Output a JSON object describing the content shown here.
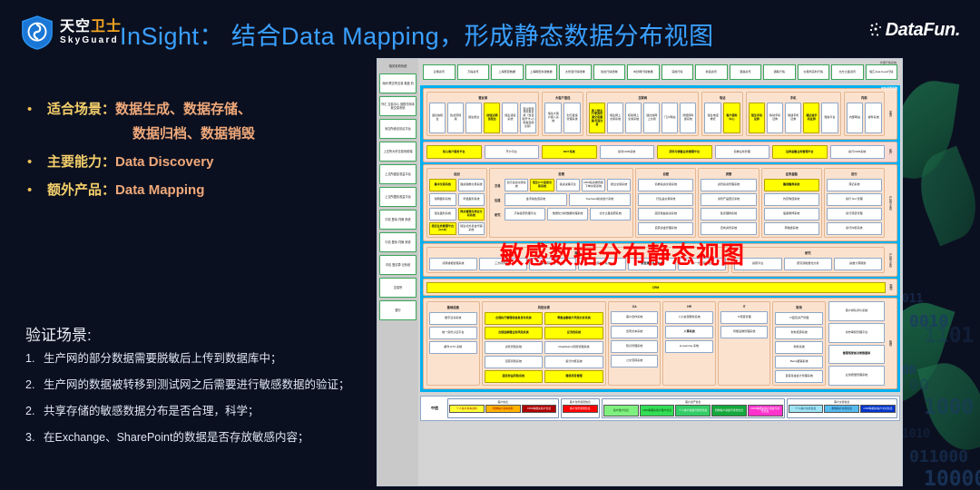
{
  "header": {
    "logo_cn_white": "天空",
    "logo_cn_yellow": "卫士",
    "logo_en": "SkyGuard",
    "title": "InSight： 结合Data Mapping，形成静态数据分布视图",
    "brand_right": "DataFun."
  },
  "bullets": [
    {
      "dot": "•",
      "label": "适合场景：",
      "value": "数据生成、数据存储、",
      "cont": "数据归档、数据销毁"
    },
    {
      "dot": "•",
      "label": "主要能力：",
      "value": "Data Discovery",
      "cont": ""
    },
    {
      "dot": "•",
      "label": "额外产品：",
      "value": "Data Mapping",
      "cont": ""
    }
  ],
  "verify": {
    "heading": "验证场景:",
    "items": [
      {
        "num": "1.",
        "text": "生产网的部分数据需要脱敏后上传到数据库中；"
      },
      {
        "num": "2.",
        "text": "生产网的数据被转移到测试网之后需要进行敏感数据的验证；"
      },
      {
        "num": "2.",
        "text": "共享存储的敏感数据分布是否合理，科学；"
      },
      {
        "num": "3.",
        "text": "在Exchange、SharePoint的数据是否存放敏感内容；"
      }
    ]
  },
  "diagram": {
    "red_overlay": "敏感数据分布静态视图",
    "side_caption": "相关机构系统",
    "side_boxes": [
      "深圳 联交所交易 报盘 机",
      "外汇 交易中心 回顾打网本 报交易系统",
      "深交所综合协议平台",
      "上交所大宗交易系统端",
      "上交所固定收益平台",
      "上交所国债收益平台",
      "中债 登标 托管 系统",
      "中债 登标 托管 系统",
      "中债 登清算 记系统",
      "交易所",
      "银行"
    ],
    "top_caption": "外部行情系统",
    "top_boxes": [
      "彭博资讯",
      "万得资讯",
      "上海聚源数据",
      "上海朝阳永续数据",
      "大智慧行情终端",
      "钱龙行情终端",
      "中钞网行情数据",
      "深成行情",
      "新浪资讯",
      "港澳资讯",
      "通联行情",
      "交易所实时行情",
      "北方之星资讯",
      "恒汇data Feed行情"
    ],
    "blue_caption": "中信证券系统",
    "channel_vert": "渠道",
    "channel_groups": [
      {
        "title": "营业部",
        "cells": [
          {
            "t": "通达信柜台",
            "hl": false
          },
          {
            "t": "钱龙现场版",
            "hl": false
          },
          {
            "t": "恒生柜台",
            "hl": false
          },
          {
            "t": "创信达期货柜台",
            "hl": true
          },
          {
            "t": "恒生通道系统",
            "hl": false
          },
          {
            "t": "营业部现场交易系统（含自助开卡+小键盘自助交易）",
            "hl": false
          }
        ]
      },
      {
        "title": "大客户直连",
        "cells": [
          {
            "t": "恒生大客户接入系统",
            "hl": false
          },
          {
            "t": "创元极速管理系统",
            "hl": false
          }
        ]
      },
      {
        "title": "互联网",
        "cells": [
          {
            "t": "网上营业厅/机构打通交易渠道/页面交易",
            "hl": true
          },
          {
            "t": "恒生网上交易系统",
            "hl": false
          },
          {
            "t": "核新网上交易系统",
            "hl": false
          },
          {
            "t": "通达信网上交易",
            "hl": false
          },
          {
            "t": "门户网站",
            "hl": false
          },
          {
            "t": "智能即时通系统",
            "hl": false
          }
        ]
      },
      {
        "title": "电话",
        "cells": [
          {
            "t": "恒生电话委托",
            "hl": false
          },
          {
            "t": "客户服务中心",
            "hl": true
          }
        ]
      },
      {
        "title": "手机",
        "cells": [
          {
            "t": "恒生手机证券",
            "hl": true
          },
          {
            "t": "移动手机证券",
            "hl": false
          },
          {
            "t": "联通手机证券",
            "hl": false
          },
          {
            "t": "通达信手机证券",
            "hl": true
          },
          {
            "t": "短信平台",
            "hl": false
          }
        ]
      },
      {
        "title": "内部",
        "cells": [
          {
            "t": "内部网站",
            "hl": false
          },
          {
            "t": "邮件系统",
            "hl": false
          }
        ]
      }
    ],
    "service_vert": "客户",
    "service_row": [
      {
        "t": "核心客户服务平台",
        "hl": true
      },
      {
        "t": "开户平台",
        "hl": false
      },
      {
        "t": "MOT系统",
        "hl": true
      },
      {
        "t": "投管CRM系统",
        "hl": false
      },
      {
        "t": "研究与销售业务管理平台",
        "hl": true
      },
      {
        "t": "债券业务管理",
        "hl": false
      },
      {
        "t": "证券金融业务管理平台",
        "hl": true
      },
      {
        "t": "投行CRM系统",
        "hl": false
      }
    ],
    "product_vert": "产品与业务",
    "biz_groups": [
      {
        "title": "经纪",
        "rows": [
          [
            {
              "t": "集中交易系统",
              "hl": true
            },
            {
              "t": "融资融券交易系统",
              "hl": false
            }
          ],
          [
            {
              "t": "恒网盈利系统",
              "hl": false
            },
            {
              "t": "华鑫盈利系统",
              "hl": false
            }
          ],
          [
            {
              "t": "恒生盈利系统",
              "hl": false
            },
            {
              "t": "网点管理与综合分析系统",
              "hl": true
            }
          ],
          [
            {
              "t": "经纪业务管理平台（BAM）",
              "hl": true
            },
            {
              "t": "恒生境外基金代销系统",
              "hl": false
            }
          ]
        ]
      },
      {
        "title": "投管",
        "labeled_rows": [
          {
            "label": "交易",
            "cells": [
              {
                "t": "创元投资交易系统",
                "hl": false
              },
              {
                "t": "恒生ETF投资交易系统",
                "hl": true
              },
              {
                "t": "投资决策平台",
                "hl": false
              },
              {
                "t": "CRM投资委员和下单交易系统",
                "hl": false
              },
              {
                "t": "柜台交易系统",
                "hl": false
              }
            ]
          },
          {
            "label": "估值",
            "cells": [
              {
                "t": "金手指估值系统",
                "hl": false
              },
              {
                "t": "SunGard投资会计系统",
                "hl": false
              }
            ]
          },
          {
            "label": "研究",
            "cells": [
              {
                "t": "万得投研管理平台",
                "hl": false
              },
              {
                "t": "数量化分析数据处理系统",
                "hl": false
              },
              {
                "t": "北方之星投研系统",
                "hl": false
              }
            ]
          }
        ]
      },
      {
        "title": "自营",
        "rows": [
          [
            {
              "t": "债券投资交易系统",
              "hl": false
            }
          ],
          [
            {
              "t": "衍生品交易系统",
              "hl": false
            }
          ],
          [
            {
              "t": "固定收益投资系统",
              "hl": false
            }
          ],
          [
            {
              "t": "自营资金管理系统",
              "hl": false
            }
          ]
        ]
      },
      {
        "title": "资管",
        "rows": [
          [
            {
              "t": "资管投资管理系统",
              "hl": false
            }
          ],
          [
            {
              "t": "资管产品登记系统",
              "hl": false
            }
          ],
          [
            {
              "t": "集合理财系统",
              "hl": false
            }
          ],
          [
            {
              "t": "定向资管系统",
              "hl": false
            }
          ]
        ]
      },
      {
        "title": "证券金融",
        "rows": [
          [
            {
              "t": "融资融券系统",
              "hl": true
            }
          ],
          [
            {
              "t": "约定购回系统",
              "hl": false
            }
          ],
          [
            {
              "t": "股票质押系统",
              "hl": false
            }
          ],
          [
            {
              "t": "转融通系统",
              "hl": false
            }
          ]
        ]
      },
      {
        "title": "投行",
        "rows": [
          [
            {
              "t": "薄记系统",
              "hl": false
            }
          ],
          [
            {
              "t": "投行 NoI 管理",
              "hl": false
            }
          ],
          [
            {
              "t": "投行项目管理",
              "hl": false
            }
          ],
          [
            {
              "t": "投行内核系统",
              "hl": false
            }
          ]
        ]
      }
    ],
    "clearing_groups": [
      {
        "title": "清算",
        "cells": [
          {
            "t": "清算或相管理系统",
            "hl": false
          },
          {
            "t": "三方存管系统",
            "hl": false
          },
          {
            "t": "清算核算系统（估值）",
            "hl": false
          },
          {
            "t": "清算统计系统",
            "hl": false
          },
          {
            "t": "新型清算法人系统",
            "hl": false,
            "bold": true
          },
          {
            "t": "新一代运营平台",
            "hl": false
          }
        ]
      },
      {
        "title": "研究",
        "cells": [
          {
            "t": "投研平台",
            "hl": false
          },
          {
            "t": "研究测验量化分析",
            "hl": false
          },
          {
            "t": "指数计算服务",
            "hl": false
          }
        ]
      }
    ],
    "crm_vert": "数据",
    "crm_label": "CRM",
    "support_vert": "管理",
    "support_groups": [
      {
        "title": "基础设施",
        "cells": [
          {
            "t": "数字证书系统",
            "hl": false
          },
          {
            "t": "统一身份认证平台",
            "hl": false
          },
          {
            "t": "邮件 RTX 系统",
            "hl": false
          }
        ]
      },
      {
        "title": "风控合规",
        "rows": [
          [
            {
              "t": "合规执行管理和信息发布系统",
              "hl": true
            },
            {
              "t": "零售金融客户风险分析系统",
              "hl": true
            }
          ],
          [
            {
              "t": "合规监察稽业务风险系统",
              "hl": true
            },
            {
              "t": "反洗钱系统",
              "hl": true
            }
          ],
          [
            {
              "t": "资管风险系统",
              "hl": false
            },
            {
              "t": "RiskMetrics风险管理系统",
              "hl": false
            }
          ],
          [
            {
              "t": "自营风险系统",
              "hl": false
            },
            {
              "t": "投行内核系统",
              "hl": false
            }
          ],
          [
            {
              "t": "固定收益风险系统",
              "hl": true
            },
            {
              "t": "稽核项目管理",
              "hl": true
            }
          ]
        ]
      },
      {
        "title": "OA",
        "cells": [
          {
            "t": "客户合作系统",
            "hl": false
          },
          {
            "t": "合同文本系统",
            "hl": false
          },
          {
            "t": "知识管理系统",
            "hl": false
          },
          {
            "t": "公文流转系统",
            "hl": false
          }
        ]
      },
      {
        "title": "HR",
        "cells": [
          {
            "t": "人力资源服务系统",
            "hl": false
          },
          {
            "t": "人事系统",
            "hl": false,
            "bold": true
          },
          {
            "t": "E-learning 系统",
            "hl": false
          }
        ]
      },
      {
        "title": "IT",
        "cells": [
          {
            "t": "IT项目管理",
            "hl": false
          },
          {
            "t": "智能运维管理系统",
            "hl": false
          }
        ]
      },
      {
        "title": "财务",
        "cells": [
          {
            "t": "IT固定资产管理",
            "hl": false
          },
          {
            "t": "财务核算系统",
            "hl": false
          },
          {
            "t": "财务系统",
            "hl": false
          },
          {
            "t": "Barra报销系统",
            "hl": false
          },
          {
            "t": "自营基金会计管理系统",
            "hl": false
          }
        ]
      }
    ],
    "mgmt_extra": [
      {
        "t": "客户排队评价系统",
        "hl": false
      },
      {
        "t": "协作审核管理平台",
        "hl": false
      },
      {
        "t": "管理驾驶舱决策数据库",
        "hl": false,
        "bold": true
      },
      {
        "t": "业务质量管理系统",
        "hl": false
      }
    ],
    "legend_logo": "中信",
    "legend_groups": [
      {
        "title": "客户信息",
        "chips": [
          {
            "t": "个人客户基本资料",
            "bg": "#ffff33",
            "fg": "#9b0000"
          },
          {
            "t": "机构客户基本资料",
            "bg": "#ffb300",
            "fg": "#9b0000"
          },
          {
            "t": "CRM等相关客户信息",
            "bg": "#b00000",
            "fg": "#ffffff"
          }
        ]
      },
      {
        "title": "客户身份鉴别信息",
        "chips": [
          {
            "t": "客户身份鉴别信息",
            "bg": "#ff0000",
            "fg": "#ffffff"
          }
        ]
      },
      {
        "title": "客户资产信息",
        "chips": [
          {
            "t": "客户账户信息",
            "bg": "#7ff07f",
            "fg": "#004400"
          },
          {
            "t": "CRM等相关客户账户信息",
            "bg": "#33dd55",
            "fg": "#003300"
          },
          {
            "t": "个人客户资金与持仓信息",
            "bg": "#33cc66",
            "fg": "#ffffff"
          },
          {
            "t": "机构客户资金与持仓信息",
            "bg": "#15a83c",
            "fg": "#ffffff"
          },
          {
            "t": "CRM等相关客户资金与持仓信息",
            "bg": "#ff33cc",
            "fg": "#ffffff"
          }
        ]
      },
      {
        "title": "客户交易信息",
        "chips": [
          {
            "t": "个人客户交易信息",
            "bg": "#9ee4f5",
            "fg": "#003355"
          },
          {
            "t": "机构客户交易信息",
            "bg": "#55bbee",
            "fg": "#002244"
          },
          {
            "t": "CRM等相关客户交易信息",
            "bg": "#0033cc",
            "fg": "#ffffff"
          }
        ]
      }
    ]
  },
  "colors": {
    "bg": "#0b1020",
    "title_blue": "#3aa0ff",
    "label_gold": "#f5d06b",
    "value_orange": "#f0a97a",
    "overlay_red": "#ff0000",
    "panel_blue": "#00b0f0",
    "highlight_yellow": "#ffff00"
  },
  "binary_rows": [
    "010",
    "1011",
    "0010",
    "1101",
    "0100",
    "000",
    "00",
    "1000",
    "101",
    "01010",
    "011000",
    "100000"
  ]
}
